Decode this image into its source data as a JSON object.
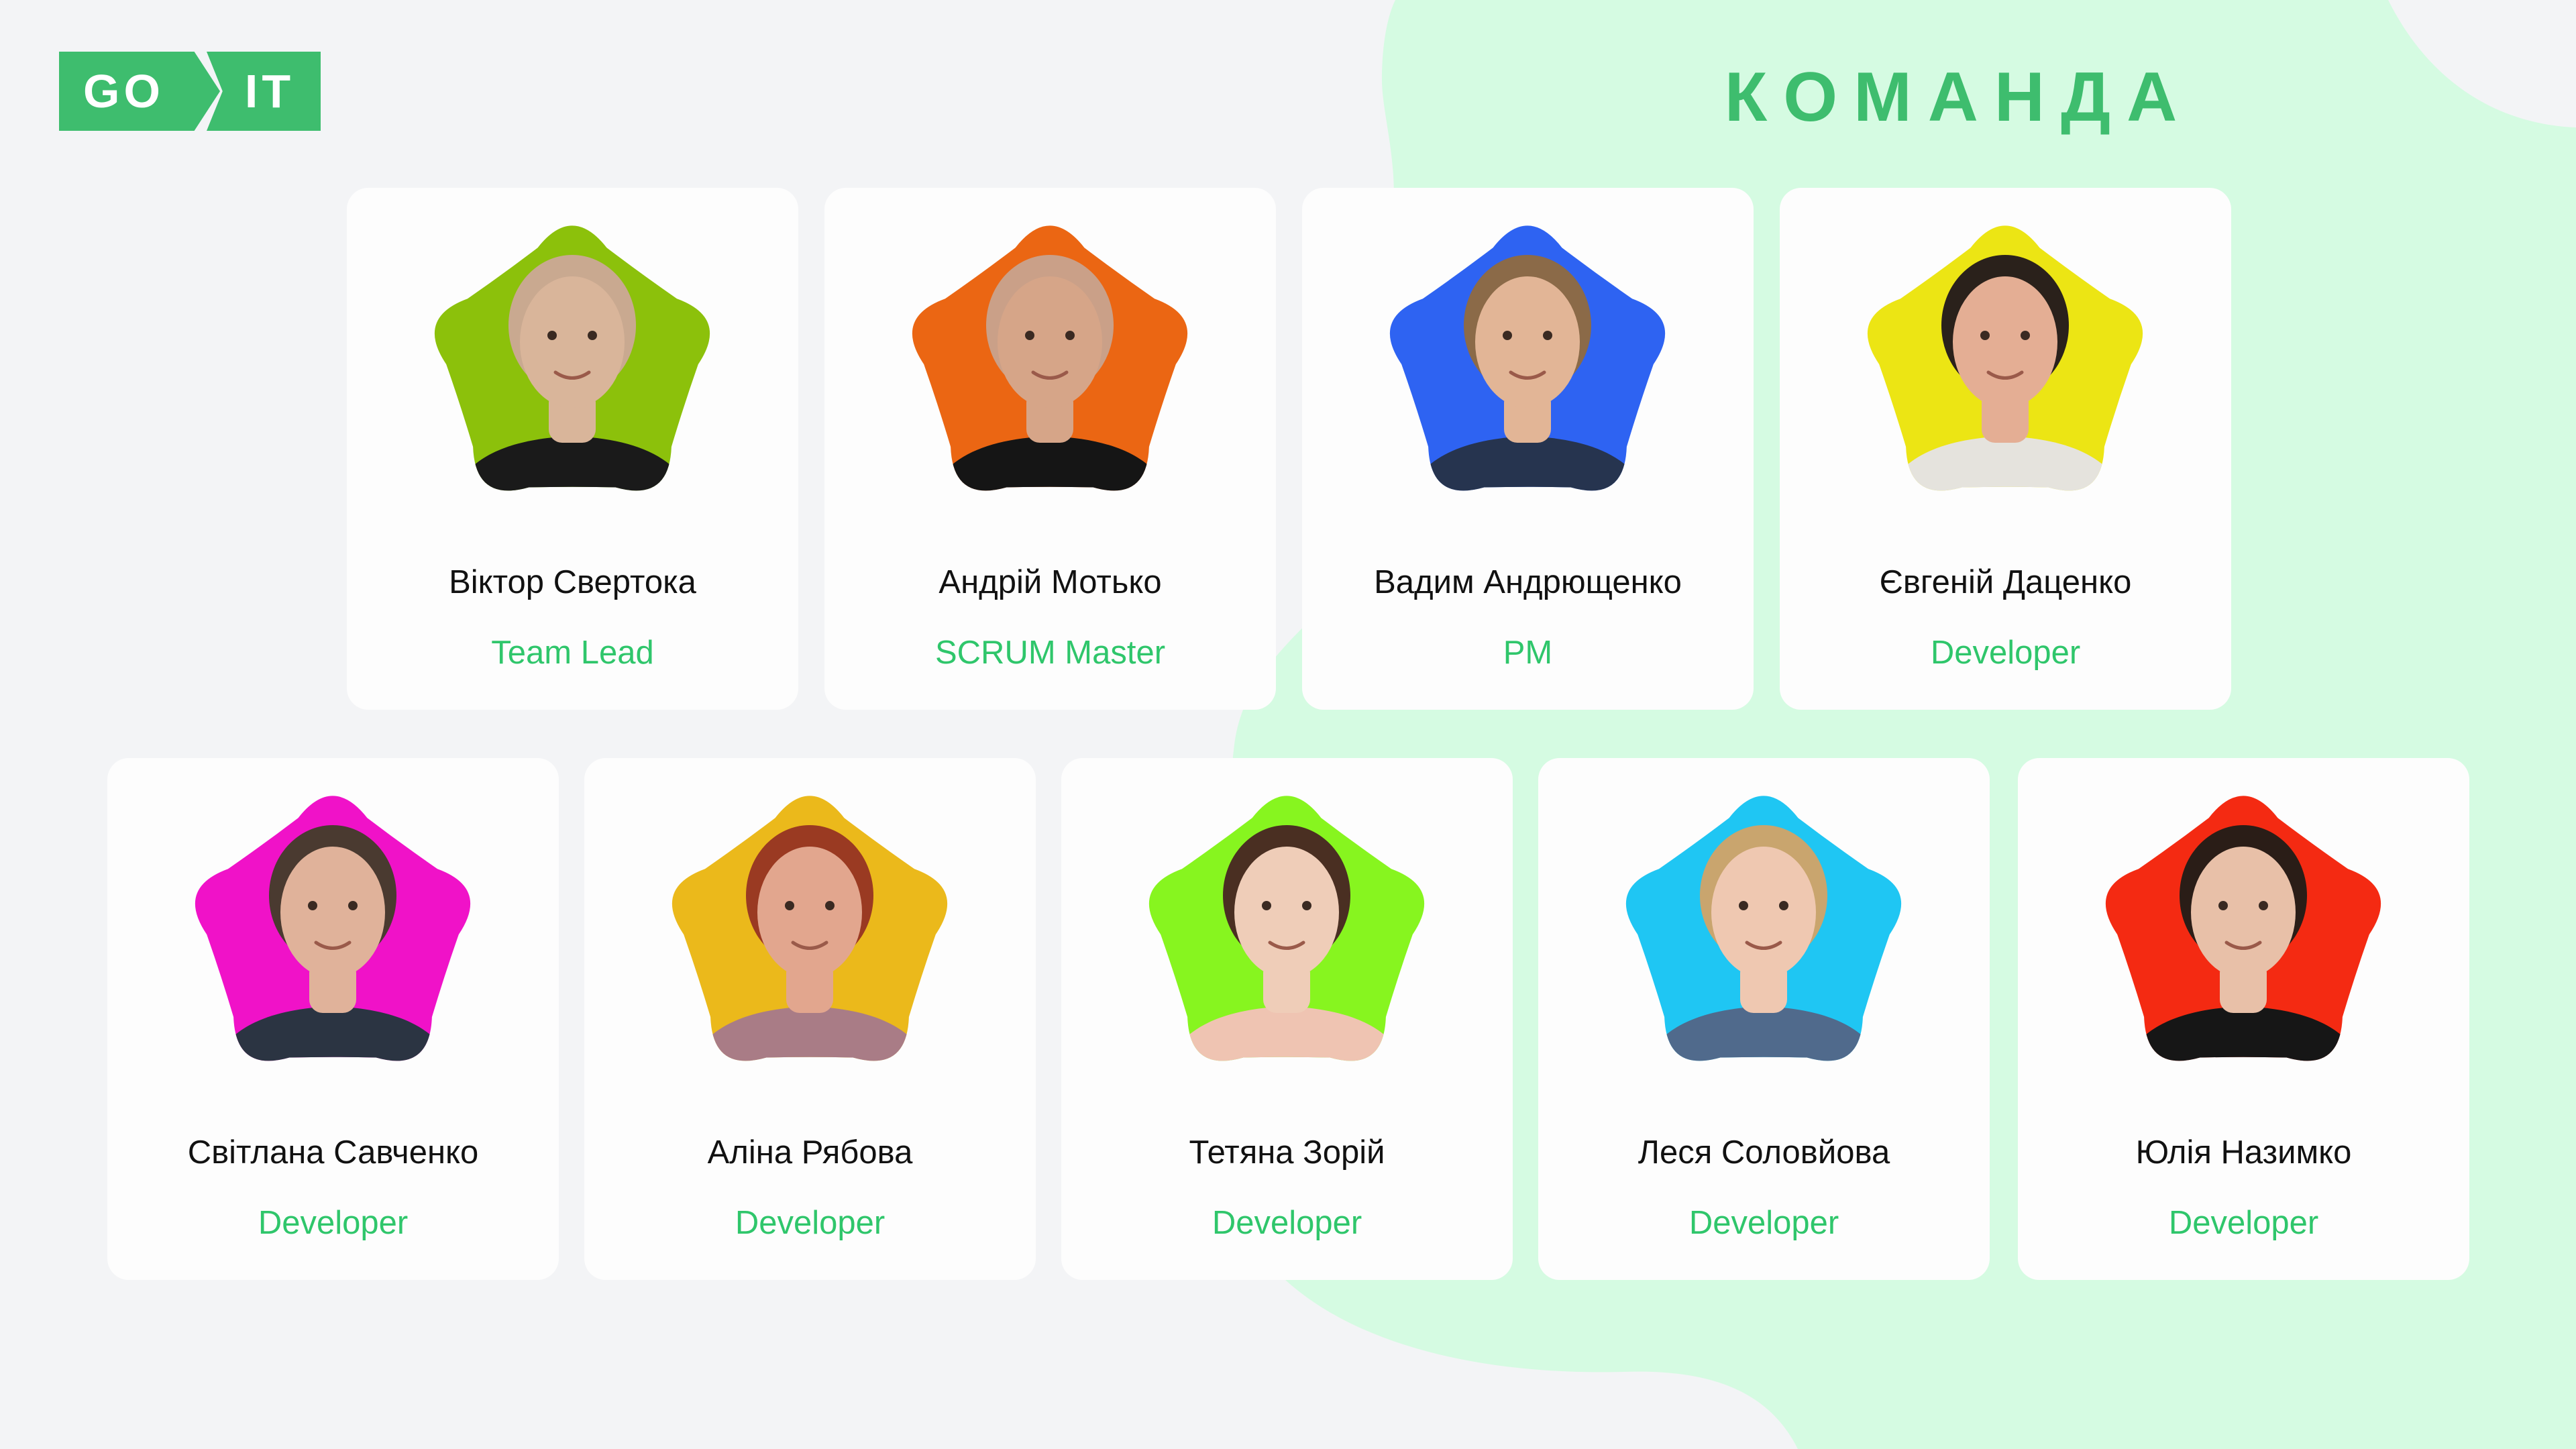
{
  "header": {
    "logo_left": "GO",
    "logo_right": "IT",
    "title": "КОМАНДА"
  },
  "colors": {
    "background": "#f3f4f6",
    "blob": "#d5fbe2",
    "accent": "#3ebd6e",
    "role_text": "#2fc66b",
    "card": "#fdfdfd"
  },
  "team": [
    {
      "name": "Віктор Свертока",
      "role": "Team Lead",
      "flower_color": "#8cc10b",
      "shirt_color": "#1a1a1a",
      "skin_color": "#d9b59a",
      "hair_color": "#c9a990"
    },
    {
      "name": "Андрій Мотько",
      "role": "SCRUM Master",
      "flower_color": "#eb6613",
      "shirt_color": "#151515",
      "skin_color": "#d6a588",
      "hair_color": "#caa088"
    },
    {
      "name": "Вадим Андрющенко",
      "role": "PM",
      "flower_color": "#2e63f2",
      "shirt_color": "#26344f",
      "skin_color": "#e2b596",
      "hair_color": "#8b6a48"
    },
    {
      "name": "Євгеній Даценко",
      "role": "Developer",
      "flower_color": "#ece514",
      "shirt_color": "#e5e3dd",
      "skin_color": "#e4ae94",
      "hair_color": "#2a211b"
    },
    {
      "name": "Світлана Савченко",
      "role": "Developer",
      "flower_color": "#f012c8",
      "shirt_color": "#2b3442",
      "skin_color": "#e0b29a",
      "hair_color": "#4a3a30"
    },
    {
      "name": "Аліна Рябова",
      "role": "Developer",
      "flower_color": "#ebb91b",
      "shirt_color": "#a97c86",
      "skin_color": "#e2a68e",
      "hair_color": "#9a3a22"
    },
    {
      "name": "Тетяна Зорій",
      "role": "Developer",
      "flower_color": "#87f51f",
      "shirt_color": "#efc4b2",
      "skin_color": "#efcdb8",
      "hair_color": "#4a2f22"
    },
    {
      "name": "Леся Соловйова",
      "role": "Developer",
      "flower_color": "#1fc6f3",
      "shirt_color": "#506a8c",
      "skin_color": "#efc8b1",
      "hair_color": "#c9a56e"
    },
    {
      "name": "Юлія Назимко",
      "role": "Developer",
      "flower_color": "#f42a12",
      "shirt_color": "#161616",
      "skin_color": "#e8c0a8",
      "hair_color": "#2a1d17"
    }
  ]
}
